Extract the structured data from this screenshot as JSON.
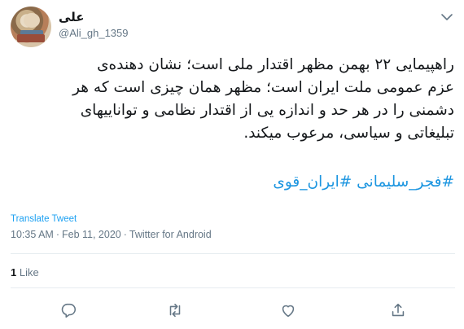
{
  "author": {
    "name": "علی",
    "handle": "@Ali_gh_1359"
  },
  "tweet": {
    "lines": [
      "راهپیمایی ۲۲ بهمن مظهر اقتدار ملی است؛ نشان دهنده‌ی",
      "عزم عمومی ملت ایران است؛ مظهر همان چیزی است که هر",
      "دشمنی را در هر حد و اندازه یی از اقتدار نظامی و تواناییهای",
      "تبلیغاتی و سیاسی، مرعوب میکند."
    ],
    "hashtags": [
      "#فجر_سلیمانی",
      "#ایران_قوی"
    ],
    "translate_label": "Translate Tweet",
    "time": "10:35 AM",
    "date": "Feb 11, 2020",
    "source": "Twitter for Android",
    "separator": "·"
  },
  "stats": {
    "likes_count": "1",
    "likes_label": "Like"
  },
  "icons": {
    "caret": "chevron-down-icon",
    "reply": "reply-icon",
    "retweet": "retweet-icon",
    "like": "heart-icon",
    "share": "share-icon"
  },
  "colors": {
    "link": "#1b95e0",
    "muted": "#657786",
    "text": "#14171a"
  }
}
